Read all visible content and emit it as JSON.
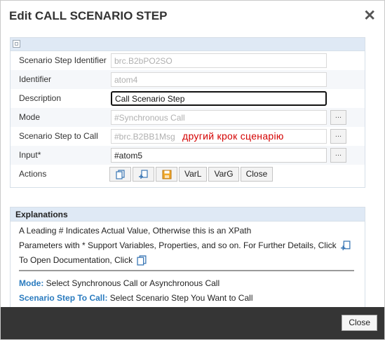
{
  "dialog": {
    "title": "Edit CALL SCENARIO STEP",
    "close_glyph": "✕"
  },
  "form": {
    "rows": [
      {
        "label": "Scenario Step Identifier",
        "value": "brc.B2bPO2SO"
      },
      {
        "label": "Identifier",
        "value": "atom4"
      },
      {
        "label": "Description",
        "value": "Call Scenario Step"
      },
      {
        "label": "Mode",
        "value": "#Synchronous Call",
        "button": "..."
      },
      {
        "label": "Scenario Step to Call",
        "value": "#brc.B2BB1Msg",
        "button": "...",
        "annotation": "другий крок сценарію"
      },
      {
        "label": "Input*",
        "value": "#atom5",
        "button": "..."
      }
    ],
    "actions": {
      "label": "Actions",
      "icons": [
        "copy-icon",
        "add-copy-icon",
        "save-icon"
      ],
      "buttons": [
        "VarL",
        "VarG",
        "Close"
      ]
    }
  },
  "explanations": {
    "heading": "Explanations",
    "line1": "A Leading # Indicates Actual Value, Otherwise this is an XPath",
    "line2": "Parameters with * Support Variables, Properties, and so on. For Further Details, Click",
    "line3": "To Open Documentation, Click",
    "mode_key": "Mode:",
    "mode_text": " Select Synchronous Call or Asynchronous Call",
    "step_key": "Scenario Step To Call:",
    "step_text": " Select Scenario Step You Want to Call"
  },
  "footer": {
    "close_label": "Close"
  },
  "colors": {
    "header_bg": "#dfe9f5",
    "footer_bg": "#353535",
    "keyword": "#2a7bbf",
    "annotation": "#d40000"
  }
}
